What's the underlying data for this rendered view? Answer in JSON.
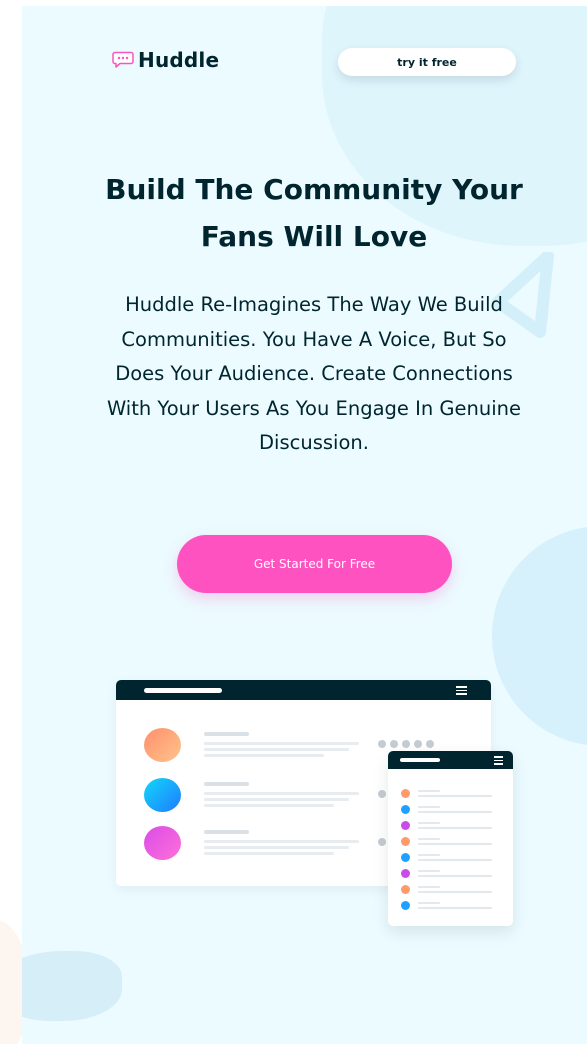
{
  "header": {
    "logo_text": "Huddle",
    "logo_icon": "chat-bubble-icon",
    "cta_label": "try it free"
  },
  "hero": {
    "headline": "Build The Community Your Fans Will Love",
    "description": "Huddle Re-Imagines The Way We Build Communities. You Have A Voice, But So Does Your Audience. Create Connections With Your Users As You Engage In Genuine Discussion.",
    "cta_label": "Get Started For Free"
  },
  "colors": {
    "brand_dark": "#00252e",
    "accent_pink": "#ff52c1",
    "background": "#ebfbff",
    "avatar_gradients": [
      "#ff8f6b-#ffb88c",
      "#1fa2ff-#12d8fa",
      "#d94de8-#ff6fd8"
    ]
  },
  "illustration": {
    "icon": "mockup-illustration"
  }
}
